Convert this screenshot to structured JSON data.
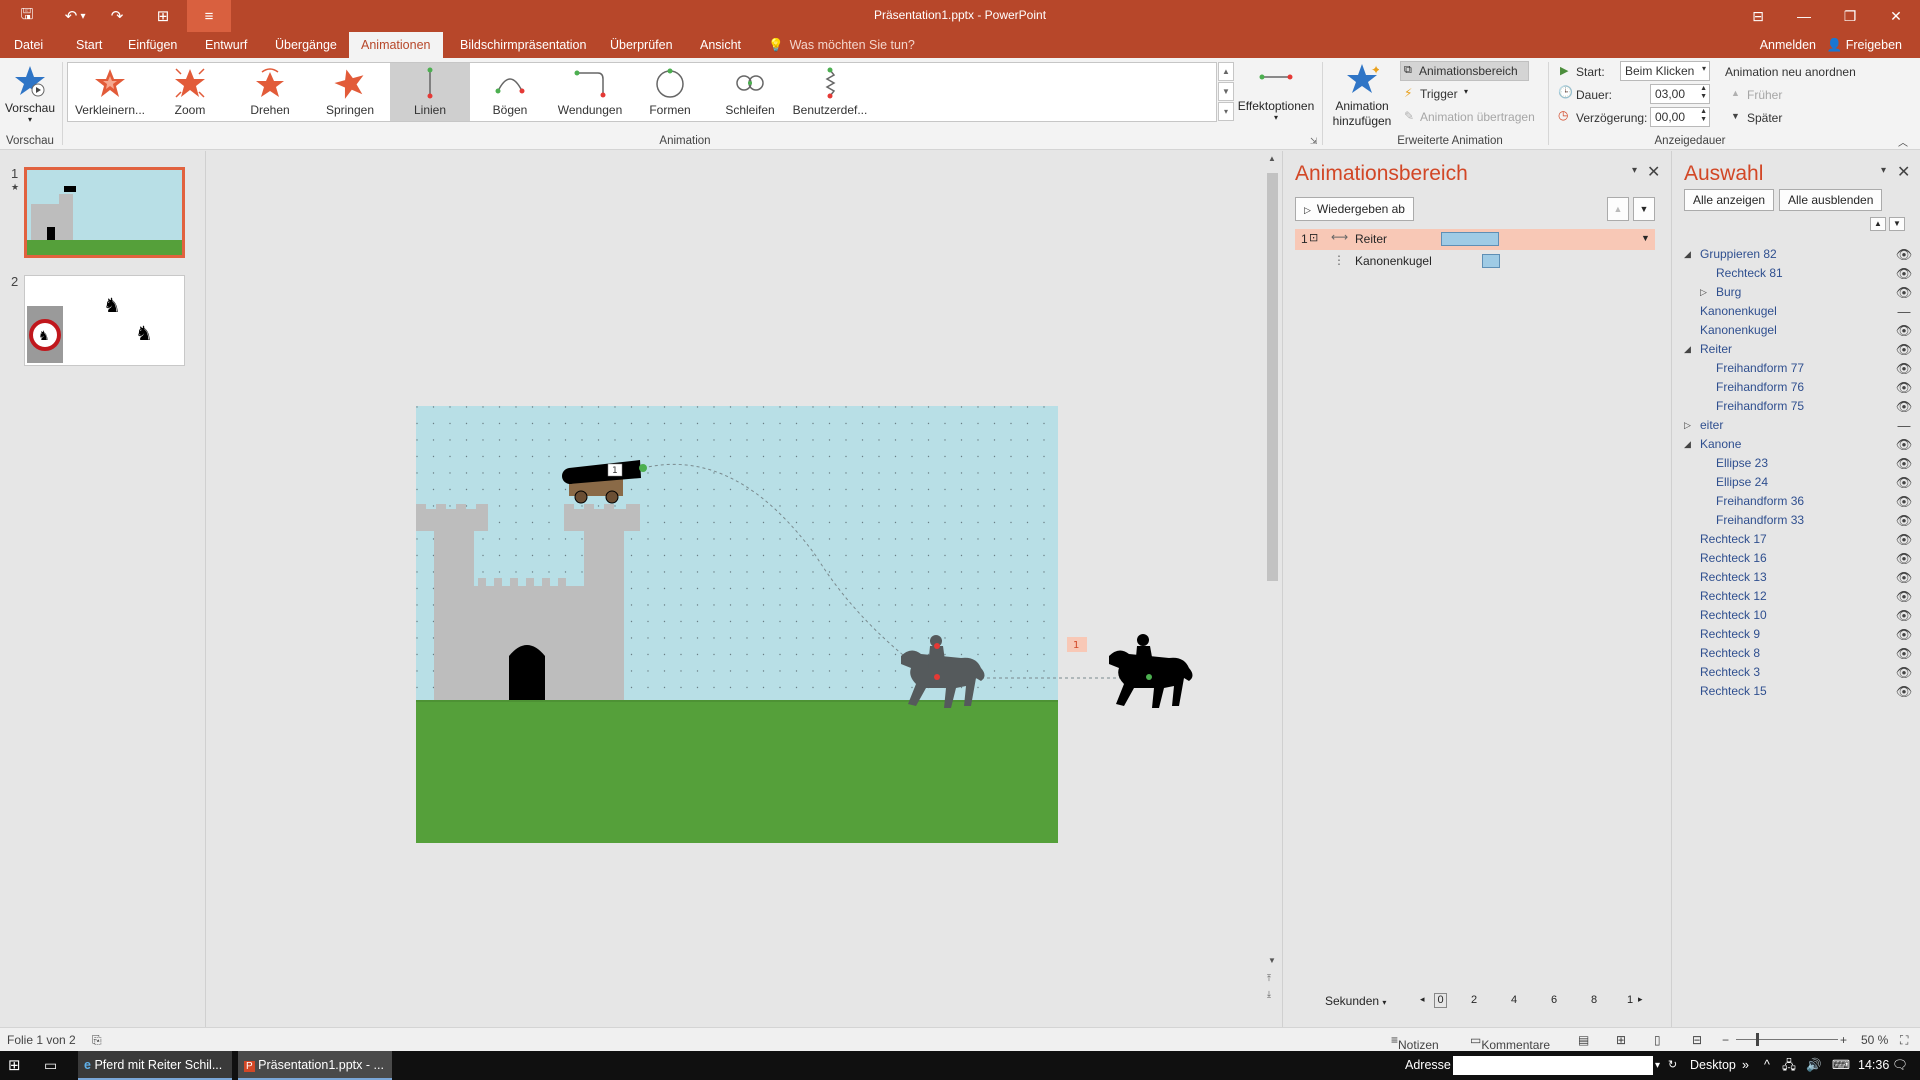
{
  "titlebar": {
    "title": "Präsentation1.pptx - PowerPoint",
    "qa_save": "🖫",
    "qa_undo": "↶",
    "qa_undo_more": "▾",
    "qa_redo": "↷",
    "qa_present": "⊞",
    "qa_custom": "≡",
    "ribbon_opts": "⊟",
    "minimize": "—",
    "restore": "❐",
    "close": "✕"
  },
  "tabs": [
    "Datei",
    "Start",
    "Einfügen",
    "Entwurf",
    "Übergänge",
    "Animationen",
    "Bildschirmpräsentation",
    "Überprüfen",
    "Ansicht"
  ],
  "tell_me": "Was möchten Sie tun?",
  "sign_in": "Anmelden",
  "share": "Freigeben",
  "ribbon": {
    "preview_label": "Vorschau",
    "preview_group": "Vorschau",
    "animations": [
      "Verkleinern...",
      "Zoom",
      "Drehen",
      "Springen",
      "Linien",
      "Bögen",
      "Wendungen",
      "Formen",
      "Schleifen",
      "Benutzerdef..."
    ],
    "animation_group": "Animation",
    "effect_options": "Effektoptionen",
    "add_animation": "Animation hinzufügen",
    "animation_pane_btn": "Animationsbereich",
    "trigger": "Trigger",
    "anim_painter": "Animation übertragen",
    "advanced_group": "Erweiterte Animation",
    "start_label": "Start:",
    "start_value": "Beim Klicken",
    "duration_label": "Dauer:",
    "duration_value": "03,00",
    "delay_label": "Verzögerung:",
    "delay_value": "00,00",
    "reorder_label": "Animation neu anordnen",
    "earlier": "Früher",
    "later": "Später",
    "timing_group": "Anzeigedauer"
  },
  "slides": [
    {
      "number": "1",
      "star": "★"
    },
    {
      "number": "2",
      "star": ""
    }
  ],
  "canvas": {
    "anim_tag": "1",
    "cannon_tag": "1"
  },
  "animpane": {
    "title": "Animationsbereich",
    "play_btn": "Wiedergeben ab",
    "items": [
      {
        "index": "1",
        "name": "Reiter"
      },
      {
        "index": "",
        "name": "Kanonenkugel"
      }
    ],
    "seconds": "Sekunden",
    "timeline_ticks": [
      "0",
      "2",
      "4",
      "6",
      "8",
      "1"
    ]
  },
  "selpane": {
    "title": "Auswahl",
    "show_all": "Alle anzeigen",
    "hide_all": "Alle ausblenden",
    "items": [
      {
        "name": "Gruppieren 82",
        "level": 0,
        "tri": "◢",
        "eye": "👁"
      },
      {
        "name": "Rechteck 81",
        "level": 1,
        "tri": "",
        "eye": "👁"
      },
      {
        "name": "Burg",
        "level": 1,
        "tri": "▷",
        "eye": "👁"
      },
      {
        "name": "Kanonenkugel",
        "level": 0,
        "tri": "",
        "eye": "—"
      },
      {
        "name": "Kanonenkugel",
        "level": 0,
        "tri": "",
        "eye": "👁"
      },
      {
        "name": "Reiter",
        "level": 0,
        "tri": "◢",
        "eye": "👁"
      },
      {
        "name": "Freihandform 77",
        "level": 1,
        "tri": "",
        "eye": "👁"
      },
      {
        "name": "Freihandform 76",
        "level": 1,
        "tri": "",
        "eye": "👁"
      },
      {
        "name": "Freihandform 75",
        "level": 1,
        "tri": "",
        "eye": "👁"
      },
      {
        "name": "eiter",
        "level": 0,
        "tri": "▷",
        "eye": "—"
      },
      {
        "name": "Kanone",
        "level": 0,
        "tri": "◢",
        "eye": "👁"
      },
      {
        "name": "Ellipse 23",
        "level": 1,
        "tri": "",
        "eye": "👁"
      },
      {
        "name": "Ellipse 24",
        "level": 1,
        "tri": "",
        "eye": "👁"
      },
      {
        "name": "Freihandform 36",
        "level": 1,
        "tri": "",
        "eye": "👁"
      },
      {
        "name": "Freihandform 33",
        "level": 1,
        "tri": "",
        "eye": "👁"
      },
      {
        "name": "Rechteck 17",
        "level": 0,
        "tri": "",
        "eye": "👁"
      },
      {
        "name": "Rechteck 16",
        "level": 0,
        "tri": "",
        "eye": "👁"
      },
      {
        "name": "Rechteck 13",
        "level": 0,
        "tri": "",
        "eye": "👁"
      },
      {
        "name": "Rechteck 12",
        "level": 0,
        "tri": "",
        "eye": "👁"
      },
      {
        "name": "Rechteck 10",
        "level": 0,
        "tri": "",
        "eye": "👁"
      },
      {
        "name": "Rechteck 9",
        "level": 0,
        "tri": "",
        "eye": "👁"
      },
      {
        "name": "Rechteck 8",
        "level": 0,
        "tri": "",
        "eye": "👁"
      },
      {
        "name": "Rechteck 3",
        "level": 0,
        "tri": "",
        "eye": "👁"
      },
      {
        "name": "Rechteck 15",
        "level": 0,
        "tri": "",
        "eye": "👁"
      }
    ]
  },
  "statusbar": {
    "slide_info": "Folie 1 von 2",
    "notes": "Notizen",
    "comments": "Kommentare",
    "zoom": "50 %"
  },
  "taskbar": {
    "app1": "Pferd mit Reiter Schil...",
    "app2": "Präsentation1.pptx - ...",
    "address_label": "Adresse",
    "desktop": "Desktop",
    "time": "14:36"
  },
  "colors": {
    "accent": "#b7472a",
    "sky": "#b8dfe6",
    "grass": "#55a03a",
    "castle": "#bdbdbd"
  }
}
